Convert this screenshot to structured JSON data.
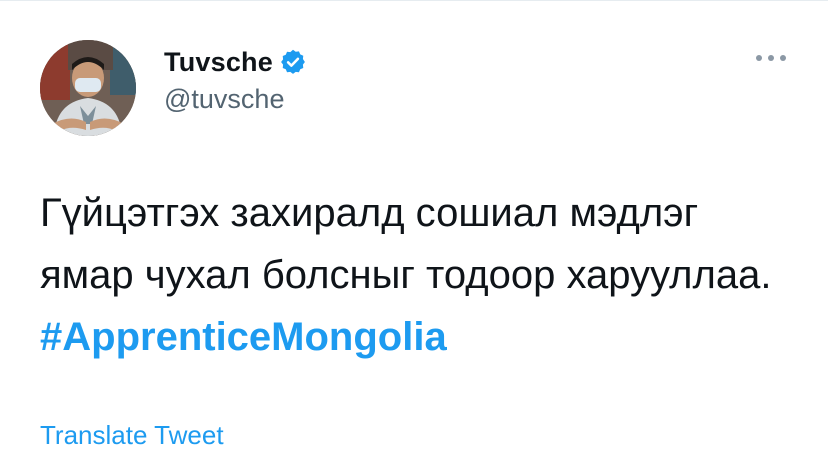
{
  "user": {
    "display_name": "Tuvsche",
    "handle": "@tuvsche",
    "verified": true,
    "avatar_icon": "profile-photo"
  },
  "more_icon": "ellipsis-icon",
  "tweet": {
    "text": "Гүйцэтгэх захиралд сошиал мэдлэг ямар чухал болсныг тодоор харууллаа.",
    "hashtag": "#ApprenticeMongolia"
  },
  "translate_label": "Translate Tweet",
  "colors": {
    "link": "#1d9bf0",
    "text": "#0f1419",
    "muted": "#536471",
    "verified_badge": "#1d9bf0"
  }
}
